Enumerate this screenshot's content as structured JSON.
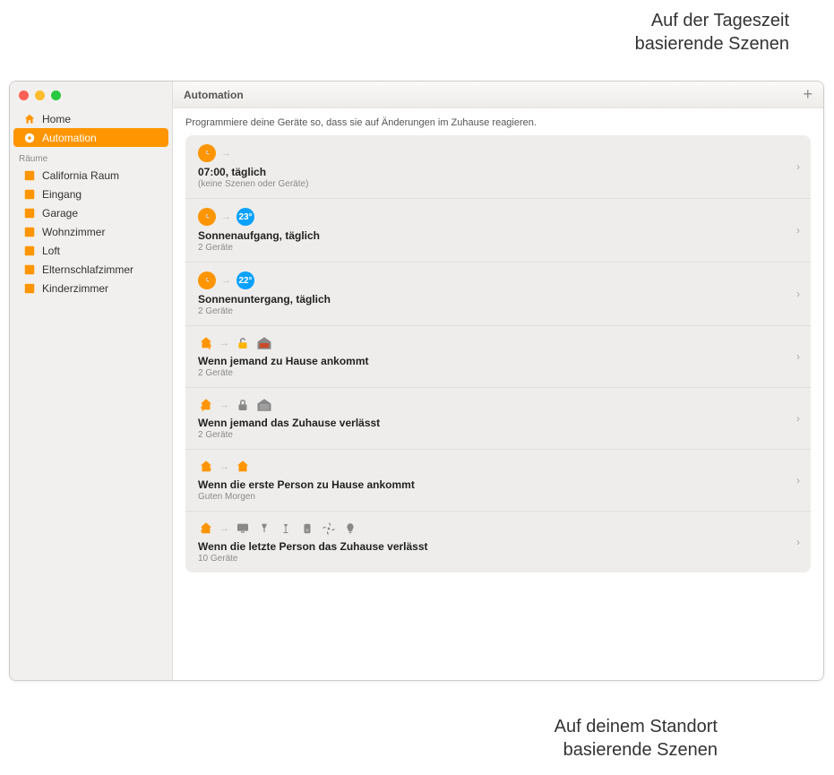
{
  "callouts": {
    "top": "Auf der Tageszeit\nbasierende Szenen",
    "bottom": "Auf deinem Standort\nbasierende Szenen"
  },
  "sidebar": {
    "items": [
      {
        "label": "Home",
        "icon": "home-icon"
      },
      {
        "label": "Automation",
        "icon": "automation-icon"
      }
    ],
    "section_label": "Räume",
    "rooms": [
      {
        "label": "California Raum"
      },
      {
        "label": "Eingang"
      },
      {
        "label": "Garage"
      },
      {
        "label": "Wohnzimmer"
      },
      {
        "label": "Loft"
      },
      {
        "label": "Elternschlafzimmer"
      },
      {
        "label": "Kinderzimmer"
      }
    ]
  },
  "header": {
    "title": "Automation"
  },
  "main": {
    "subtitle": "Programmiere deine Geräte so, dass sie auf Änderungen im Zuhause reagieren.",
    "automations": [
      {
        "name": "07:00, täglich",
        "sub": "(keine Szenen oder Geräte)",
        "kind": "clock",
        "badge": ""
      },
      {
        "name": "Sonnenaufgang, täglich",
        "sub": "2 Geräte",
        "kind": "clock",
        "badge": "23°"
      },
      {
        "name": "Sonnenuntergang, täglich",
        "sub": "2 Geräte",
        "kind": "clock",
        "badge": "22°"
      },
      {
        "name": "Wenn jemand zu Hause ankommt",
        "sub": "2 Geräte",
        "kind": "arrive"
      },
      {
        "name": "Wenn jemand das Zuhause verlässt",
        "sub": "2 Geräte",
        "kind": "leave"
      },
      {
        "name": "Wenn die erste Person zu Hause ankommt",
        "sub": "Guten Morgen",
        "kind": "first"
      },
      {
        "name": "Wenn die letzte Person das Zuhause verlässt",
        "sub": "10 Geräte",
        "kind": "last"
      }
    ]
  },
  "colors": {
    "accent": "#ff9500",
    "blue_badge": "#0aa1ff"
  }
}
